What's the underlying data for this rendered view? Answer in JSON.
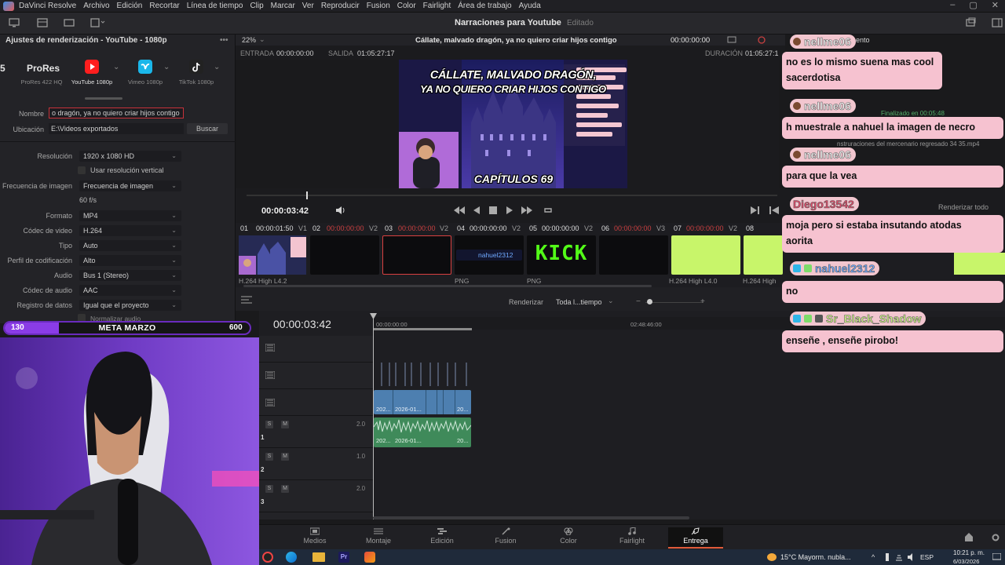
{
  "menubar": {
    "app_name": "DaVinci Resolve",
    "items": [
      "Archivo",
      "Edición",
      "Recortar",
      "Línea de tiempo",
      "Clip",
      "Marcar",
      "Ver",
      "Reproducir",
      "Fusion",
      "Color",
      "Fairlight",
      "Área de trabajo",
      "Ayuda"
    ]
  },
  "toolbar": {
    "project_title": "Narraciones para Youtube",
    "status": "Editado"
  },
  "render_settings": {
    "panel_title": "Ajustes de renderización - YouTube - 1080p",
    "presets": [
      {
        "label": "ProRes 422 HQ"
      },
      {
        "label": "YouTube 1080p"
      },
      {
        "label": "Vimeo 1080p"
      },
      {
        "label": "TikTok 1080p"
      }
    ],
    "preset_top_label": "ProRes",
    "name_label": "Nombre",
    "name_value": "o dragón, ya no quiero criar hijos contigo",
    "location_label": "Ubicación",
    "location_value": "E:\\Videos exportados",
    "browse_button": "Buscar",
    "resolution_label": "Resolución",
    "resolution_value": "1920 x 1080 HD",
    "vertical_label": "Usar resolución vertical",
    "framerate_label": "Frecuencia de imagen",
    "framerate_value": "Frecuencia de imagen",
    "fps_value": "60 f/s",
    "format_label": "Formato",
    "format_value": "MP4",
    "video_codec_label": "Códec de video",
    "video_codec_value": "H.264",
    "type_label": "Tipo",
    "type_value": "Auto",
    "profile_label": "Perfil de codificación",
    "profile_value": "Alto",
    "audio_label": "Audio",
    "audio_value": "Bus 1 (Stereo)",
    "audio_codec_label": "Códec de audio",
    "audio_codec_value": "AAC",
    "data_log_label": "Registro de datos",
    "data_log_value": "Igual que el proyecto",
    "normalize_label": "Normalizar audio"
  },
  "viewer": {
    "zoom": "22%",
    "clip_title": "Cállate, malvado dragón, ya no quiero criar hijos contigo",
    "timecode_top": "00:00:00:00",
    "in_label": "ENTRADA",
    "in_value": "00:00:00:00",
    "out_label": "SALIDA",
    "out_value": "01:05:27:17",
    "duration_label": "DURACIÓN",
    "duration_value": "01:05:27:1",
    "preview_line1": "CÁLLATE, MALVADO DRAGÓN,",
    "preview_line2": "YA NO QUIERO CRIAR HIJOS CONTIGO",
    "preview_badge": "CAPÍTULOS 69",
    "current_timecode": "00:00:03:42"
  },
  "render_queue": {
    "render_all": "Renderizar todo"
  },
  "clips": [
    {
      "num": "01",
      "tc": "00:00:01:50",
      "track": "V1",
      "codec": "H.264 High L4.2"
    },
    {
      "num": "02",
      "tc": "00:00:00:00",
      "track": "V2",
      "codec": ""
    },
    {
      "num": "03",
      "tc": "00:00:00:00",
      "track": "V2",
      "codec": ""
    },
    {
      "num": "04",
      "tc": "00:00:00:00",
      "track": "V2",
      "codec": "PNG"
    },
    {
      "num": "05",
      "tc": "00:00:00:00",
      "track": "V2",
      "codec": "PNG"
    },
    {
      "num": "06",
      "tc": "00:00:00:00",
      "track": "V3",
      "codec": ""
    },
    {
      "num": "07",
      "tc": "00:00:00:00",
      "track": "V2",
      "codec": "H.264 High L4.0"
    },
    {
      "num": "08",
      "tc": "",
      "track": "",
      "codec": "H.264 High"
    }
  ],
  "clip_overlay": {
    "kick": "KICK",
    "nahuel_tag": "nahuel2312"
  },
  "timeline_header": {
    "render_label": "Renderizar",
    "range_value": "Toda l...tiempo"
  },
  "timeline": {
    "timecode": "00:00:03:42",
    "ruler_start": "00:00:00:00",
    "ruler_mid": "02:48:46:00",
    "video_clip_labels": [
      "202...",
      "2026-01...",
      "20..."
    ],
    "audio_clip_labels": [
      "202...",
      "2026-01...",
      "20..."
    ],
    "audio_tracks": [
      {
        "num": "1",
        "level": "2.0"
      },
      {
        "num": "2",
        "level": "1.0"
      },
      {
        "num": "3",
        "level": "2.0"
      }
    ]
  },
  "pages": [
    {
      "label": "Medios",
      "icon": "media-icon"
    },
    {
      "label": "Montaje",
      "icon": "cut-icon"
    },
    {
      "label": "Edición",
      "icon": "edit-icon"
    },
    {
      "label": "Fusion",
      "icon": "fusion-icon"
    },
    {
      "label": "Color",
      "icon": "color-icon"
    },
    {
      "label": "Fairlight",
      "icon": "fairlight-icon"
    },
    {
      "label": "Entrega",
      "icon": "deliver-icon",
      "active": true
    }
  ],
  "taskbar": {
    "weather": "15°C  Mayorm. nubla...",
    "lang": "ESP",
    "time": "10:21 p. m.",
    "date": "6/03/2026"
  },
  "goal": {
    "current": "130",
    "title": "META MARZO",
    "target": "600",
    "progress_fraction": 0.22
  },
  "chat": [
    {
      "user": "nellme06",
      "text": "no es lo mismo suena mas cool sacerdotisa",
      "lines": [
        "no es lo mismo suena mas cool",
        "sacerdotisa"
      ]
    },
    {
      "user": "nellme06",
      "text": "h muestrale a nahuel la imagen de necro",
      "lines": [
        "h muestrale a nahuel la imagen de necro"
      ]
    },
    {
      "user": "nellme06",
      "text": "para que la vea",
      "lines": [
        "para que la vea"
      ]
    },
    {
      "user": "Diego13542",
      "text": "moja pero si estaba insutando atodas aorita",
      "lines": [
        "moja pero si estaba insutando atodas",
        "aorita"
      ]
    },
    {
      "user": "nahuel2312",
      "text": "no",
      "lines": [
        "no"
      ]
    },
    {
      "user": "Sr_Black_Shadow",
      "text": "enseñe , enseñe pirobo!",
      "lines": [
        "enseñe , enseñe pirobo!"
      ]
    }
  ],
  "chat_under_text": {
    "ento": "ento",
    "finalizado": "Finalizado en 00:05:48",
    "file": "nstruraciones del mercenario regresado 34 35.mp4"
  },
  "colors": {
    "accent_red": "#e05a3a",
    "kick_green": "#53fc18",
    "lime_clip": "#c8f56a",
    "chat_pink": "#f6c2d0",
    "goal_purple": "#6a2bbd",
    "video_clip_blue": "#4d7fb0",
    "audio_clip_green": "#3f8a5a"
  }
}
